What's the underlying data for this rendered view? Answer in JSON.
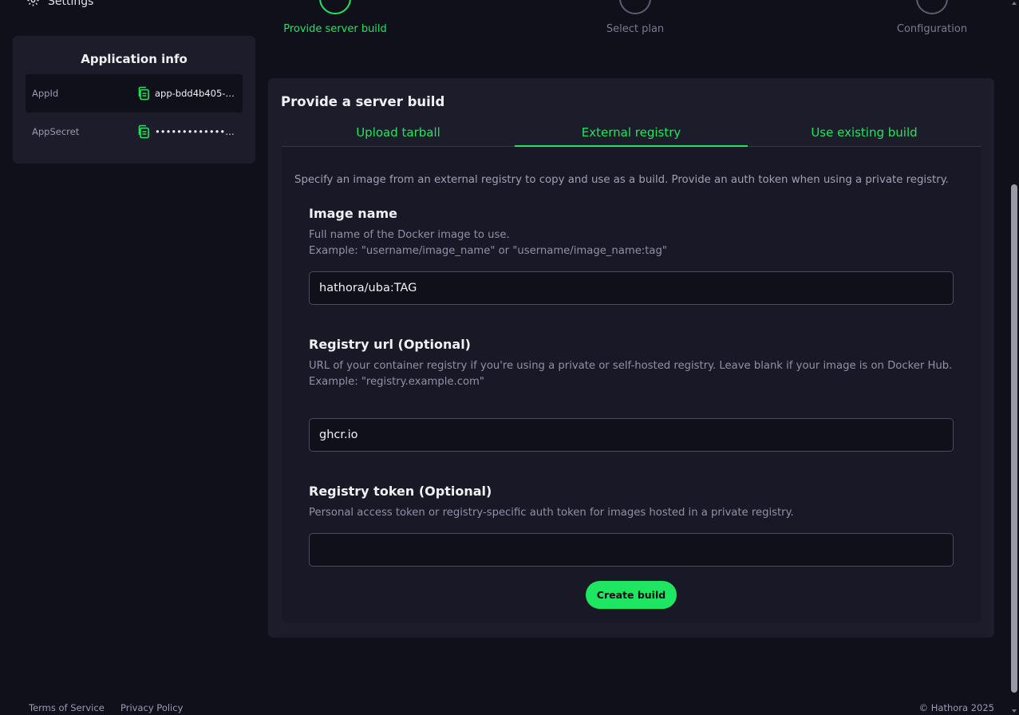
{
  "sidebar": {
    "settings_label": "Settings",
    "app_info": {
      "title": "Application info",
      "rows": [
        {
          "key": "AppId",
          "value": "app-bdd4b405-…"
        },
        {
          "key": "AppSecret",
          "value": "••••••••••••••••••••••…"
        }
      ]
    }
  },
  "stepper": {
    "steps": [
      {
        "label": "Provide server build",
        "state": "active"
      },
      {
        "label": "Select plan",
        "state": "pending"
      },
      {
        "label": "Configuration",
        "state": "pending"
      }
    ]
  },
  "card": {
    "title": "Provide a server build",
    "tabs": [
      {
        "label": "Upload tarball",
        "selected": false
      },
      {
        "label": "External registry",
        "selected": true
      },
      {
        "label": "Use existing build",
        "selected": false
      }
    ],
    "intro": "Specify an image from an external registry to copy and use as a build. Provide an auth token when using a private registry.",
    "fields": {
      "image_name": {
        "label": "Image name",
        "desc_line1": "Full name of the Docker image to use.",
        "desc_line2": "Example: \"username/image_name\" or \"username/image_name:tag\"",
        "value": "hathora/uba:TAG"
      },
      "registry_url": {
        "label": "Registry url (Optional)",
        "desc_line1": "URL of your container registry if you're using a private or self-hosted registry. Leave blank if your image is on Docker Hub.",
        "desc_line2": "Example: \"registry.example.com\"",
        "value": "ghcr.io"
      },
      "registry_token": {
        "label": "Registry token (Optional)",
        "desc_line1": "Personal access token or registry-specific auth token for images hosted in a private registry.",
        "value": ""
      }
    },
    "create_button": "Create build"
  },
  "footer": {
    "terms": "Terms of Service",
    "privacy": "Privacy Policy",
    "copyright": "© Hathora 2025"
  },
  "colors": {
    "accent": "#1ee660",
    "background": "#10101b",
    "card": "#1c1c2a"
  },
  "icons": [
    "gear-icon",
    "copy-icon",
    "check-icon"
  ]
}
